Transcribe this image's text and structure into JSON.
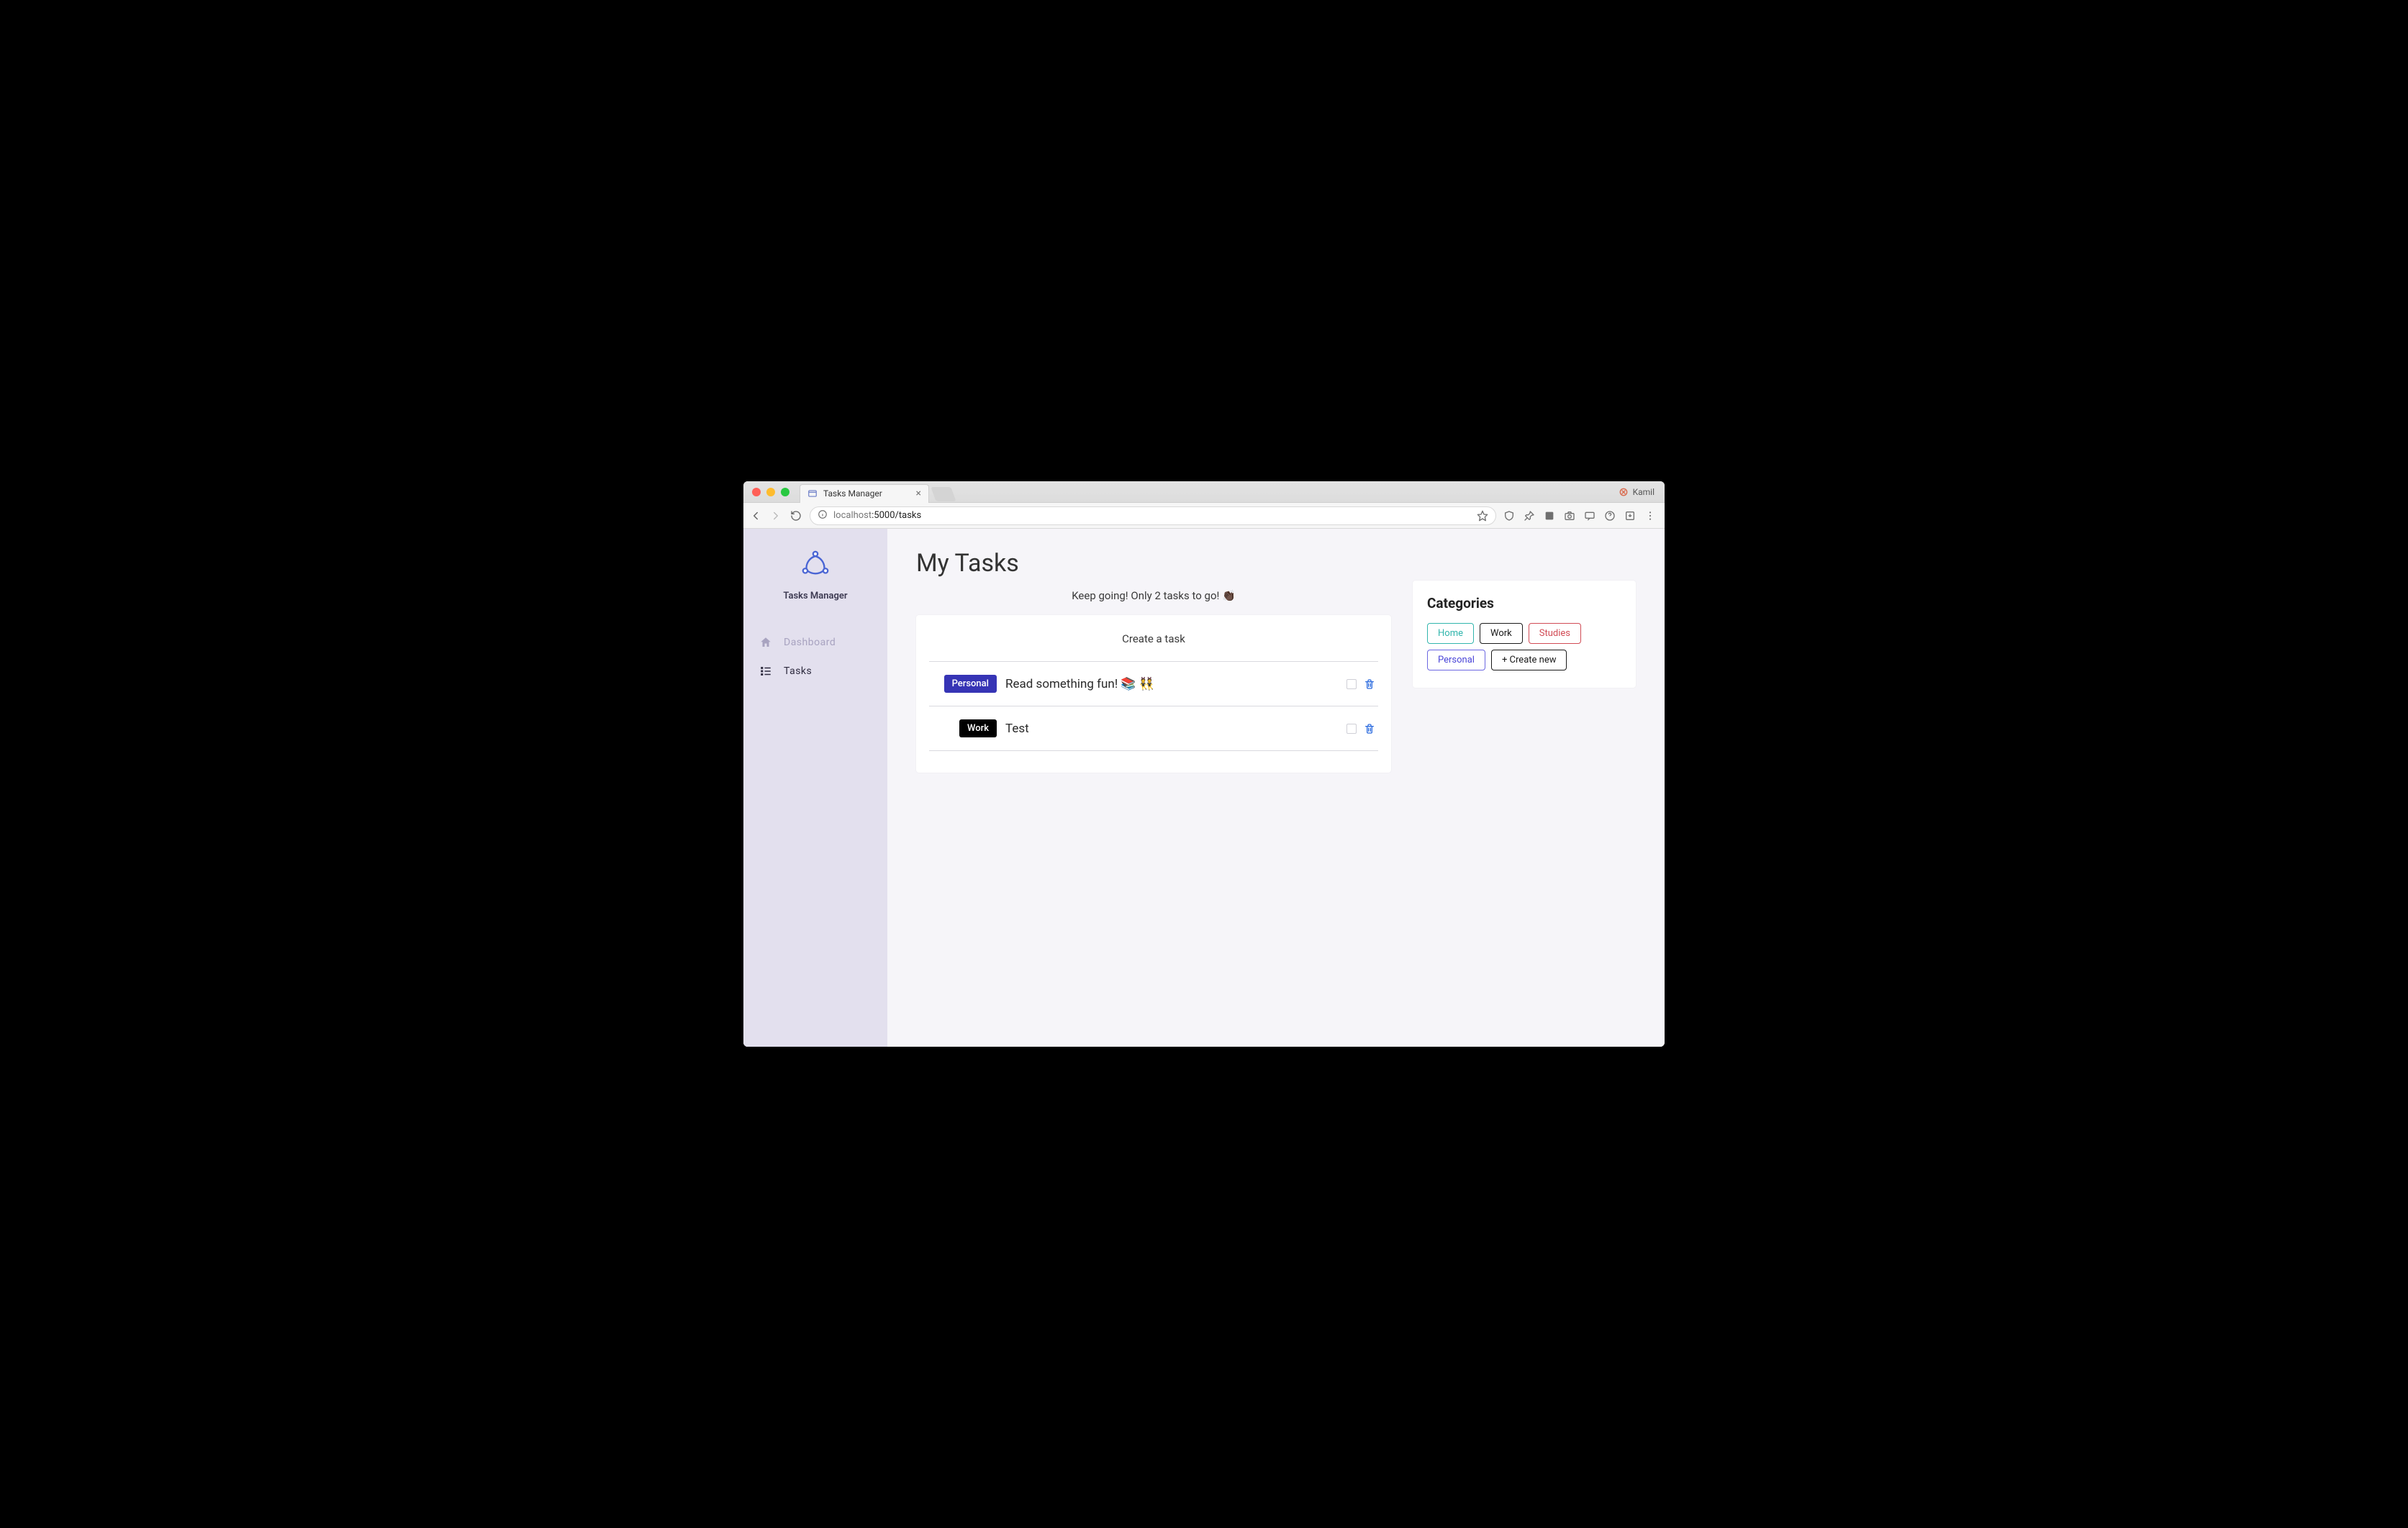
{
  "browser": {
    "tab_title": "Tasks Manager",
    "profile_name": "Kamil",
    "url_host": "localhost",
    "url_port_path": ":5000/tasks"
  },
  "sidebar": {
    "brand": "Tasks Manager",
    "items": [
      {
        "label": "Dashboard"
      },
      {
        "label": "Tasks"
      }
    ]
  },
  "page": {
    "title": "My Tasks",
    "subtext": "Keep going! Only 2 tasks to go! 👏🏿",
    "create_label": "Create a task"
  },
  "tasks": [
    {
      "badge": "Personal",
      "badge_style": "personal",
      "title": "Read something fun! 📚 👯"
    },
    {
      "badge": "Work",
      "badge_style": "work",
      "title": "Test"
    }
  ],
  "categories": {
    "title": "Categories",
    "items": [
      {
        "label": "Home",
        "style": "home"
      },
      {
        "label": "Work",
        "style": "work"
      },
      {
        "label": "Studies",
        "style": "studies"
      },
      {
        "label": "Personal",
        "style": "personal"
      },
      {
        "label": "+ Create new",
        "style": "create"
      }
    ]
  }
}
